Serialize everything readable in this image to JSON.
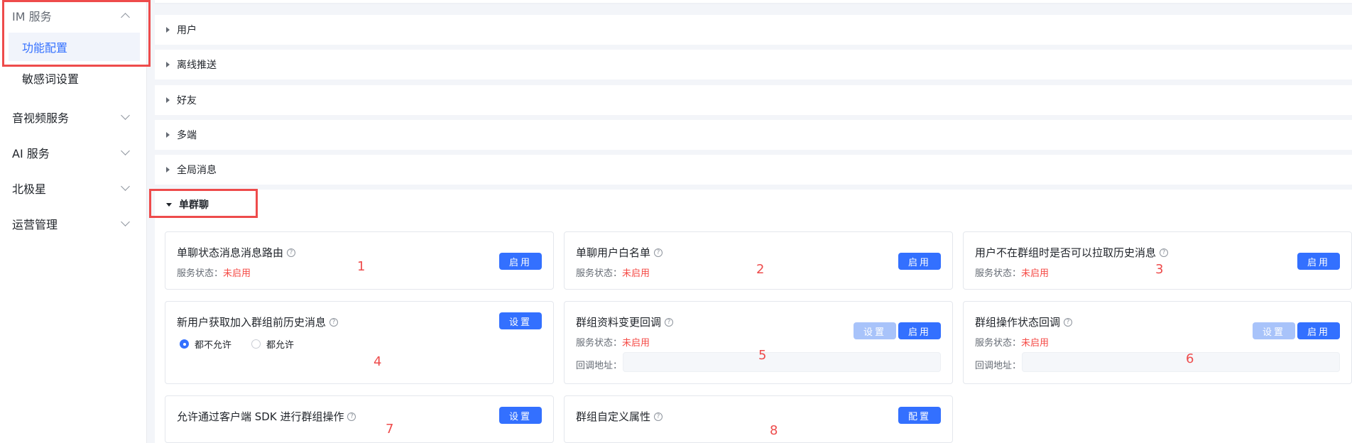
{
  "sidebar": {
    "groups": [
      {
        "label": "IM 服务",
        "expanded": true
      },
      {
        "label": "音视频服务",
        "expanded": false
      },
      {
        "label": "AI 服务",
        "expanded": false
      },
      {
        "label": "北极星",
        "expanded": false
      },
      {
        "label": "运营管理",
        "expanded": false
      }
    ],
    "im_items": [
      {
        "label": "功能配置",
        "active": true
      },
      {
        "label": "敏感词设置",
        "active": false
      }
    ]
  },
  "sections": [
    {
      "label": "用户",
      "expanded": false
    },
    {
      "label": "离线推送",
      "expanded": false
    },
    {
      "label": "好友",
      "expanded": false
    },
    {
      "label": "多端",
      "expanded": false
    },
    {
      "label": "全局消息",
      "expanded": false
    },
    {
      "label": "单群聊",
      "expanded": true
    }
  ],
  "status_label": "服务状态：",
  "status_value": "未启用",
  "callback_label": "回调地址：",
  "cards": [
    {
      "title": "单聊状态消息消息路由",
      "button": "启用",
      "marker": "1"
    },
    {
      "title": "单聊用户白名单",
      "button": "启用",
      "marker": "2"
    },
    {
      "title": "用户不在群组时是否可以拉取历史消息",
      "button": "启用",
      "marker": "3"
    },
    {
      "title": "新用户获取加入群组前历史消息",
      "button": "设置",
      "marker": "4",
      "options": [
        {
          "label": "都不允许",
          "selected": true
        },
        {
          "label": "都允许",
          "selected": false
        }
      ]
    },
    {
      "title": "群组资料变更回调",
      "button_secondary": "设置",
      "button": "启用",
      "marker": "5"
    },
    {
      "title": "群组操作状态回调",
      "button_secondary": "设置",
      "button": "启用",
      "marker": "6"
    },
    {
      "title": "允许通过客户端 SDK 进行群组操作",
      "button": "设置",
      "marker": "7"
    },
    {
      "title": "群组自定义属性",
      "button": "配置",
      "marker": "8"
    }
  ],
  "help_icon": "question-circle-icon",
  "colors": {
    "accent": "#3370ff",
    "danger": "#f54a45",
    "annotation": "#ee4b4b"
  }
}
